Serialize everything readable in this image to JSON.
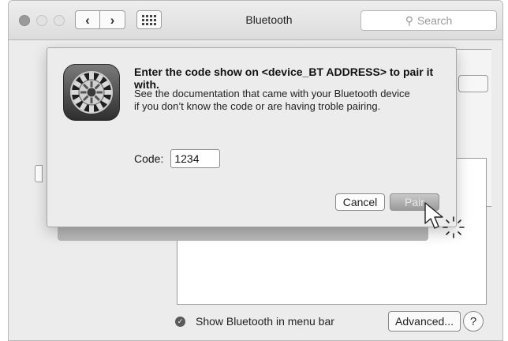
{
  "window": {
    "title": "Bluetooth"
  },
  "toolbar": {
    "back_label": "‹",
    "forward_label": "›"
  },
  "search": {
    "placeholder": "Search",
    "icon": "search-icon"
  },
  "dialog": {
    "heading": "Enter the code show on <device_BT ADDRESS> to pair it with.",
    "description_line1": "See the documentation that came with your Bluetooth device",
    "description_line2": "if you don’t know the code or are having troble pairing.",
    "code_label": "Code:",
    "code_value": "1234",
    "cancel_label": "Cancel",
    "pair_label": "Pair",
    "icon": "system-preferences-gear-icon"
  },
  "footer": {
    "show_in_menu_bar_label": "Show Bluetooth in menu bar",
    "advanced_label": "Advanced...",
    "help_label": "?"
  },
  "colors": {
    "window_bg": "#ececec",
    "pair_button": "#aaaaaa",
    "traffic_close": "#9a9a9a"
  }
}
